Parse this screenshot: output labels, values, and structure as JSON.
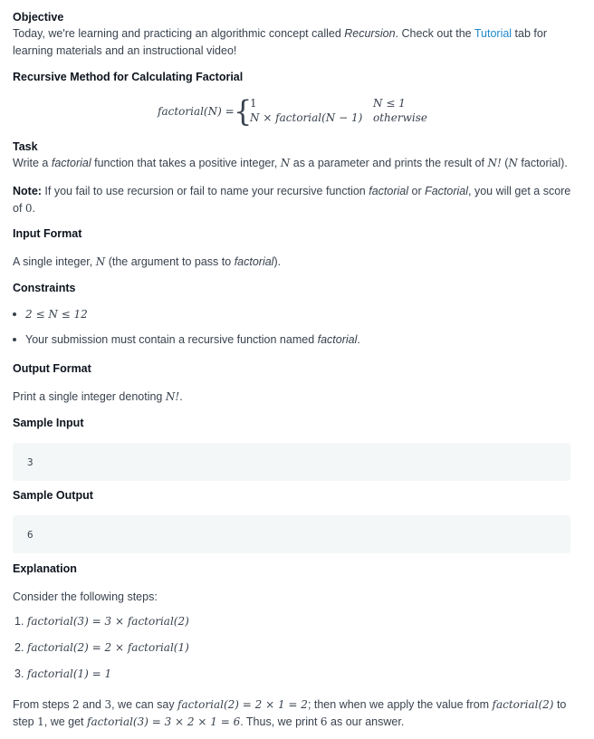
{
  "objective": {
    "heading": "Objective",
    "text_before_em": "Today, we're learning and practicing an algorithmic concept called ",
    "em": "Recursion",
    "text_mid": ". Check out the ",
    "link": "Tutorial",
    "text_after": " tab for learning materials and an instructional video!"
  },
  "recursive_method": {
    "heading": "Recursive Method for Calculating Factorial",
    "lhs": "factorial(N) =",
    "case1_value": "1",
    "case1_condition": "N ≤ 1",
    "case2_value": "N × factorial(N − 1)",
    "case2_condition": "otherwise"
  },
  "task": {
    "heading": "Task",
    "t1": "Write a ",
    "em_factorial": "factorial",
    "t2": " function that takes a positive integer, ",
    "m_n": "N",
    "t3": " as a parameter and prints the result of ",
    "m_nfact": "N!",
    "t4": " (",
    "m_n2": "N",
    "t5": " factorial)."
  },
  "note": {
    "label": "Note:",
    "t1": " If you fail to use recursion or fail to name your recursive function ",
    "em1": "factorial",
    "t2": " or ",
    "em2": "Factorial",
    "t3": ", you will get a score of ",
    "m_zero": "0",
    "t4": "."
  },
  "input_format": {
    "heading": "Input Format",
    "t1": "A single integer, ",
    "m_n": "N",
    "t2": " (the argument to pass to ",
    "em": "factorial",
    "t3": ")."
  },
  "constraints": {
    "heading": "Constraints",
    "item1": "2 ≤ N ≤ 12",
    "item2_text": "Your submission must contain a recursive function named ",
    "item2_em": "factorial",
    "item2_end": "."
  },
  "output_format": {
    "heading": "Output Format",
    "t1": "Print a single integer denoting ",
    "m_nfact": "N!",
    "t2": "."
  },
  "sample_input": {
    "heading": "Sample Input",
    "value": "3"
  },
  "sample_output": {
    "heading": "Sample Output",
    "value": "6"
  },
  "explanation": {
    "heading": "Explanation",
    "intro": "Consider the following steps:",
    "steps": [
      {
        "num": "1.",
        "expr": "factorial(3) = 3 × factorial(2)"
      },
      {
        "num": "2.",
        "expr": "factorial(2) = 2 × factorial(1)"
      },
      {
        "num": "3.",
        "expr": "factorial(1) = 1"
      }
    ],
    "c1": "From steps ",
    "c_m2": "2",
    "c2": " and ",
    "c_m3": "3",
    "c3": ", we can say ",
    "c_m4": "factorial(2) = 2 × 1 = 2",
    "c4": "; then when we apply the value from ",
    "c_m5": "factorial(2)",
    "c5": " to step ",
    "c_m6": "1",
    "c6": ", we get ",
    "c_m7": "factorial(3) = 3 × 2 × 1 = 6",
    "c7": ". Thus, we print ",
    "c_m8": "6",
    "c8": " as our answer."
  }
}
